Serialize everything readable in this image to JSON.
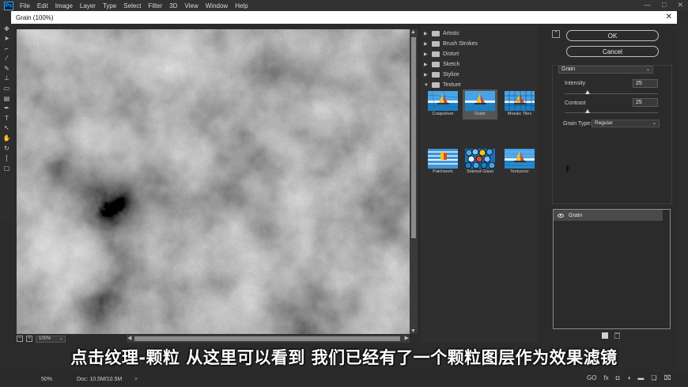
{
  "app": {
    "logo": "Ps",
    "menu": [
      "File",
      "Edit",
      "Image",
      "Layer",
      "Type",
      "Select",
      "Filter",
      "3D",
      "View",
      "Window",
      "Help"
    ],
    "window_controls": [
      "—",
      "□",
      "✕"
    ]
  },
  "dialog": {
    "title": "Grain (100%)",
    "close_glyph": "✕"
  },
  "toolbar": {
    "tools": [
      "move-tool-icon",
      "lasso-icon",
      "crop-icon",
      "eyedropper-icon",
      "brush-icon",
      "stamp-icon",
      "eraser-icon",
      "gradient-icon",
      "pen-icon",
      "type-icon",
      "path-select-icon",
      "hand-icon",
      "rotate-icon"
    ]
  },
  "preview": {
    "zoom": "100%",
    "minus": "−",
    "plus": "+"
  },
  "gallery": {
    "folders": [
      {
        "label": "Artistic",
        "open": false
      },
      {
        "label": "Brush Strokes",
        "open": false
      },
      {
        "label": "Distort",
        "open": false
      },
      {
        "label": "Sketch",
        "open": false
      },
      {
        "label": "Stylize",
        "open": false
      },
      {
        "label": "Texture",
        "open": true
      }
    ],
    "filters": [
      {
        "label": "Craquelure",
        "selected": false
      },
      {
        "label": "Grain",
        "selected": true
      },
      {
        "label": "Mosaic Tiles",
        "selected": false
      },
      {
        "label": "Patchwork",
        "selected": false
      },
      {
        "label": "Stained Glass",
        "selected": false
      },
      {
        "label": "Texturizer",
        "selected": false
      }
    ]
  },
  "settings": {
    "ok": "OK",
    "cancel": "Cancel",
    "filter": "Grain",
    "intensity_label": "Intensity",
    "intensity": "25",
    "contrast_label": "Contrast",
    "contrast": "25",
    "grain_type_label": "Grain Type:",
    "grain_type": "Regular"
  },
  "effect_layers": [
    {
      "name": "Grain",
      "visible": true
    }
  ],
  "status": {
    "zoom": "50%",
    "doc": "Doc: 10.5M/10.5M",
    "arrow": ">"
  },
  "layer_panel_icons": [
    "GO",
    "fx",
    "mask-icon",
    "adjustment-icon",
    "folder-icon",
    "new-layer-icon",
    "trash-icon"
  ],
  "subtitle": "点击纹理-颗粒 从这里可以看到 我们已经有了一个颗粒图层作为效果滤镜",
  "colors": {
    "ui_dark": "#2b2b2b",
    "menubar": "#323232",
    "accent_ps": "#31a8ff"
  }
}
